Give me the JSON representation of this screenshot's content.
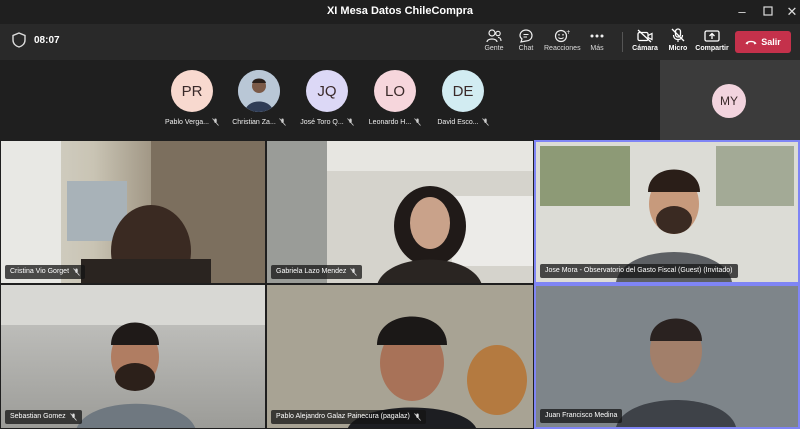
{
  "window": {
    "title": "XI Mesa Datos ChileCompra"
  },
  "toolbar": {
    "time": "08:07",
    "buttons": [
      {
        "label": "Gente",
        "icon": "people-icon"
      },
      {
        "label": "Chat",
        "icon": "chat-icon"
      },
      {
        "label": "Reacciones",
        "icon": "reactions-icon"
      },
      {
        "label": "Más",
        "icon": "more-icon"
      },
      {
        "label": "Cámara",
        "icon": "camera-off-icon"
      },
      {
        "label": "Micro",
        "icon": "mic-off-icon"
      },
      {
        "label": "Compartir",
        "icon": "share-icon"
      }
    ],
    "leave_label": "Salir"
  },
  "roster": [
    {
      "initials": "PR",
      "name": "Pablo Verga...",
      "color": "#f8d9cf"
    },
    {
      "initials": "",
      "name": "Christian Za...",
      "color": "#8aa4c4"
    },
    {
      "initials": "JQ",
      "name": "José Toro Q...",
      "color": "#dcd8f6"
    },
    {
      "initials": "LO",
      "name": "Leonardo H...",
      "color": "#f6d6dc"
    },
    {
      "initials": "DE",
      "name": "David Esco...",
      "color": "#d2ecf2"
    }
  ],
  "self": {
    "initials": "MY"
  },
  "tiles": [
    {
      "name": "Cristina Vio Gorget"
    },
    {
      "name": "Gabriela Lazo Mendez"
    },
    {
      "name": "Jose Mora - Observatorio del Gasto Fiscal (Guest) (Invitado)"
    },
    {
      "name": "Sebastian Gomez"
    },
    {
      "name": "Pablo Alejandro Galaz Painecura (pagalaz)"
    },
    {
      "name": "Juan Francisco Medina"
    }
  ],
  "colors": {
    "accent": "#7f85f5",
    "leave": "#c4314b"
  }
}
